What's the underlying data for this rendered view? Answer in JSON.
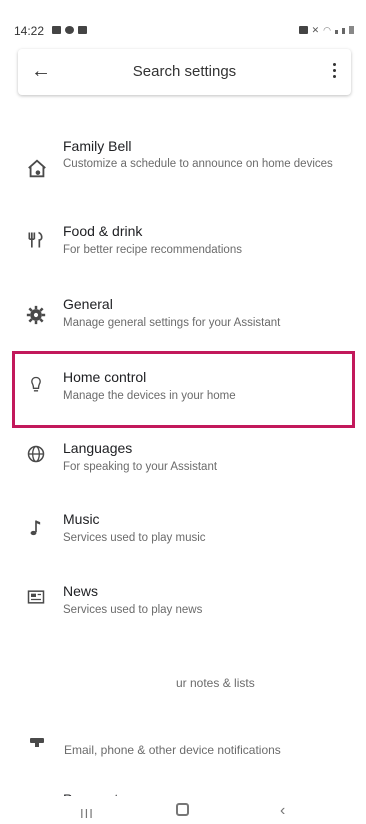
{
  "status": {
    "time": "14:22"
  },
  "search": {
    "placeholder": "Search settings"
  },
  "settings": [
    {
      "title": "Family Bell",
      "subtitle": "Customize a schedule to announce on home devices",
      "icon": "home-bell-icon"
    },
    {
      "title": "Food & drink",
      "subtitle": "For better recipe recommendations",
      "icon": "fork-knife-icon"
    },
    {
      "title": "General",
      "subtitle": "Manage general settings for your Assistant",
      "icon": "gear-icon"
    },
    {
      "title": "Home control",
      "subtitle": "Manage the devices in your home",
      "icon": "lightbulb-icon"
    },
    {
      "title": "Languages",
      "subtitle": "For speaking to your Assistant",
      "icon": "globe-icon"
    },
    {
      "title": "Music",
      "subtitle": "Services used to play music",
      "icon": "music-note-icon"
    },
    {
      "title": "News",
      "subtitle": "Services used to play news",
      "icon": "news-icon"
    }
  ],
  "partial": {
    "notes": "ur notes & lists",
    "notifications": "Email, phone & other device notifications",
    "cutoff_title": "Payments"
  },
  "highlight_color": "#c2185b"
}
